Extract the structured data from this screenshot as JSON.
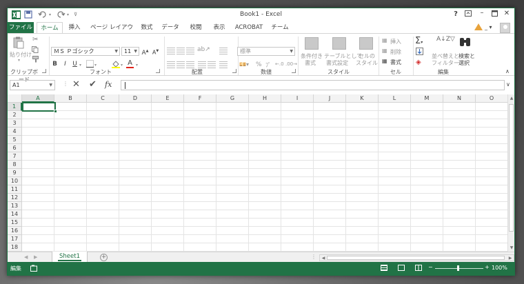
{
  "app": {
    "title": "Book1 - Excel",
    "accent": "#217346"
  },
  "titlebar": {
    "quick_access": [
      "excel-logo-icon",
      "save-icon",
      "undo-icon",
      "redo-icon",
      "customize-qat-icon"
    ],
    "help": "?",
    "controls": [
      "ribbon-display-icon",
      "minimize-icon",
      "restore-icon",
      "close-icon"
    ]
  },
  "tabs": [
    "ファイル",
    "ホーム",
    "挿入",
    "ページ レイアウト",
    "数式",
    "データ",
    "校閲",
    "表示",
    "ACROBAT",
    "チーム"
  ],
  "active_tab": "ホーム",
  "ribbon": {
    "clipboard": {
      "paste": "貼り付け",
      "label": "クリップボード"
    },
    "font": {
      "name": "ＭＳ Ｐゴシック",
      "size": "11",
      "label": "フォント",
      "bold": "B",
      "italic": "I",
      "underline": "U"
    },
    "alignment": {
      "label": "配置"
    },
    "number": {
      "format": "標準",
      "percent": "%",
      "comma": "ﾌﾟ",
      "label": "数値"
    },
    "styles": {
      "conditional": [
        "条件付き",
        "書式"
      ],
      "table": [
        "テーブルとして",
        "書式設定"
      ],
      "cell_styles": [
        "セルの",
        "スタイル"
      ],
      "label": "スタイル"
    },
    "cells": {
      "insert": "挿入",
      "delete": "削除",
      "format": "書式",
      "label": "セル"
    },
    "editing": {
      "sort": [
        "並べ替えと",
        "フィルター"
      ],
      "find": [
        "検索と",
        "選択"
      ],
      "label": "編集"
    }
  },
  "formula_bar": {
    "name_box": "A1",
    "fx": "fx",
    "value": ""
  },
  "grid": {
    "columns": [
      "A",
      "B",
      "C",
      "D",
      "E",
      "F",
      "G",
      "H",
      "I",
      "J",
      "K",
      "L",
      "M",
      "N",
      "O"
    ],
    "rows": [
      "1",
      "2",
      "3",
      "4",
      "5",
      "6",
      "7",
      "8",
      "9",
      "10",
      "11",
      "12",
      "13",
      "14",
      "15",
      "16",
      "17",
      "18"
    ],
    "active_cell": "A1"
  },
  "sheets": {
    "tabs": [
      "Sheet1"
    ],
    "active": "Sheet1",
    "add": "+"
  },
  "status": {
    "mode": "編集",
    "zoom": "100%"
  }
}
